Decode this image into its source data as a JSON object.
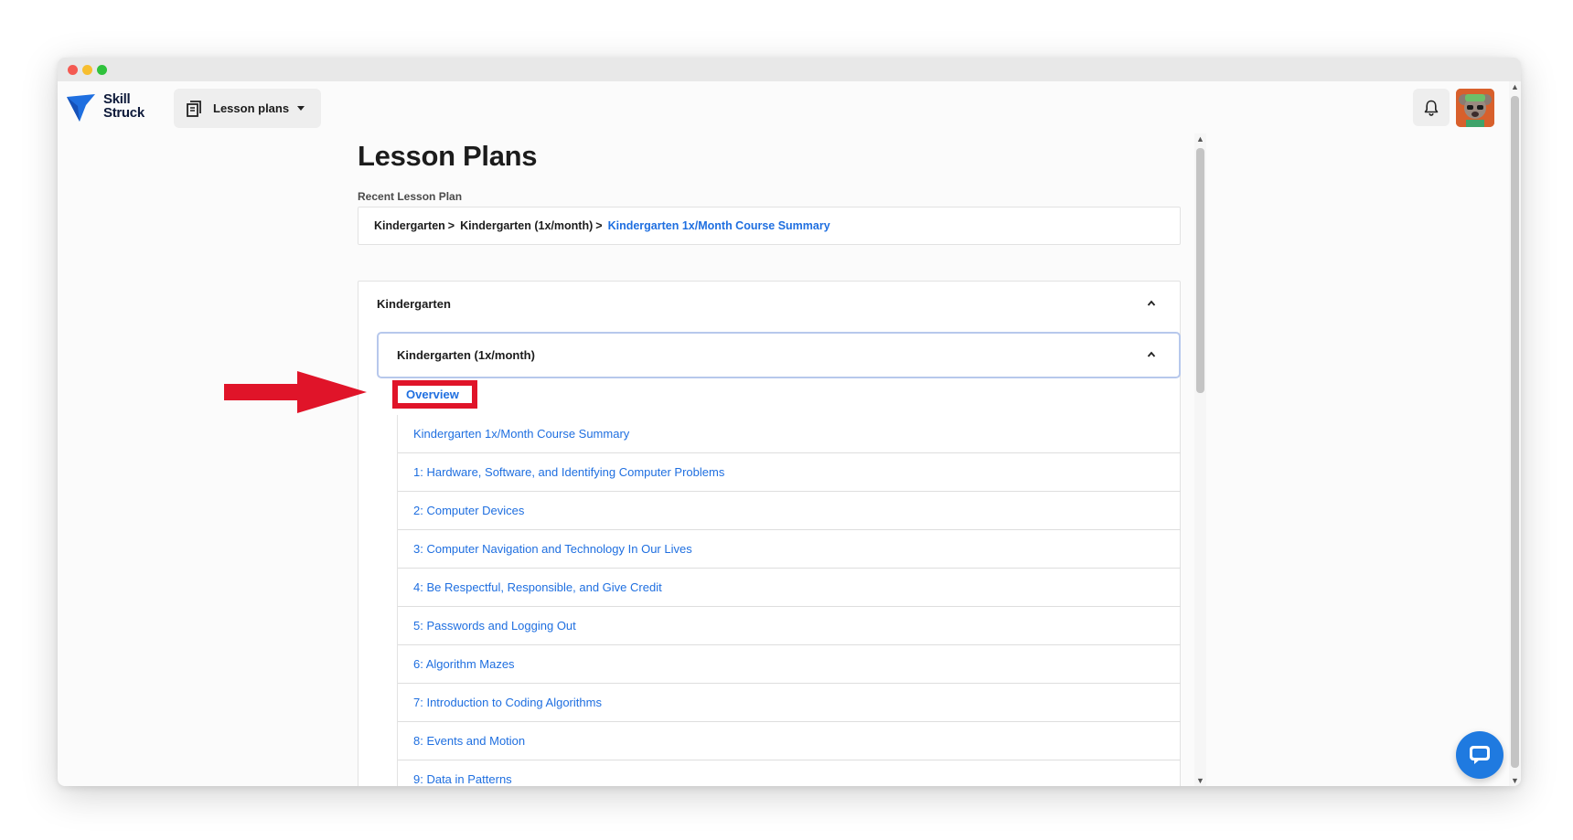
{
  "app": {
    "logo_line1": "Skill",
    "logo_line2": "Struck",
    "brand_color": "#1f6fe0"
  },
  "header": {
    "nav_dropdown_label": "Lesson plans",
    "nav_dropdown_icon": "book-icon",
    "notification_icon": "bell-icon"
  },
  "page": {
    "title": "Lesson Plans",
    "recent_label": "Recent Lesson Plan",
    "breadcrumb": {
      "item1": "Kindergarten",
      "item2": "Kindergarten (1x/month)",
      "item3": "Kindergarten 1x/Month Course Summary",
      "separator": ">"
    }
  },
  "accordion": {
    "title": "Kindergarten",
    "sub": {
      "title": "Kindergarten (1x/month)",
      "overview_label": "Overview",
      "lessons": [
        "Kindergarten 1x/Month Course Summary",
        "1: Hardware, Software, and Identifying Computer Problems",
        "2: Computer Devices",
        "3: Computer Navigation and Technology In Our Lives",
        "4: Be Respectful, Responsible, and Give Credit",
        "5: Passwords and Logging Out",
        "6: Algorithm Mazes",
        "7: Introduction to Coding Algorithms",
        "8: Events and Motion",
        "9: Data in Patterns"
      ]
    }
  },
  "annotation": {
    "highlight_color": "#e01429"
  }
}
